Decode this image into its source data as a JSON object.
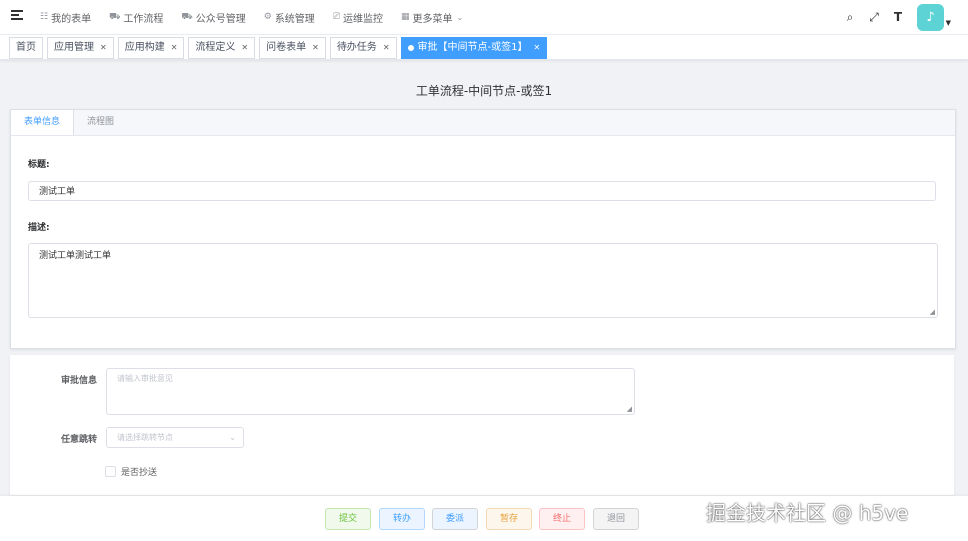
{
  "navbar": {
    "menu": [
      {
        "label": "我的表单",
        "icon": "form-icon",
        "glyph": "☷"
      },
      {
        "label": "工作流程",
        "icon": "cart-icon",
        "glyph": "⛟"
      },
      {
        "label": "公众号管理",
        "icon": "cart-icon",
        "glyph": "⛟"
      },
      {
        "label": "系统管理",
        "icon": "gear-icon",
        "glyph": "⚙"
      },
      {
        "label": "运维监控",
        "icon": "monitor-icon",
        "glyph": "⎚"
      },
      {
        "label": "更多菜单",
        "icon": "grid-icon",
        "glyph": "▦"
      }
    ],
    "tools": {
      "search": "⌕",
      "fullscreen": "⤢",
      "size": "T"
    },
    "avatar": "♪"
  },
  "tags": [
    {
      "label": "首页",
      "closable": false,
      "active": false
    },
    {
      "label": "应用管理",
      "closable": true,
      "active": false
    },
    {
      "label": "应用构建",
      "closable": true,
      "active": false
    },
    {
      "label": "流程定义",
      "closable": true,
      "active": false
    },
    {
      "label": "问卷表单",
      "closable": true,
      "active": false
    },
    {
      "label": "待办任务",
      "closable": true,
      "active": false
    },
    {
      "label": "审批【中间节点-或签1】",
      "closable": true,
      "active": true
    }
  ],
  "page": {
    "title": "工单流程-中间节点-或签1",
    "tabs": [
      "表单信息",
      "流程图"
    ],
    "form": {
      "title_label": "标题:",
      "title_value": "测试工单",
      "desc_label": "描述:",
      "desc_value": "测试工单测试工单"
    }
  },
  "approval": {
    "info_label": "审批信息",
    "info_placeholder": "请输入审批意见",
    "jump_label": "任意跳转",
    "jump_placeholder": "请选择跳转节点",
    "cc_label": "是否抄送"
  },
  "actions": {
    "submit": "提交",
    "transfer": "转办",
    "delegate": "委派",
    "save": "暂存",
    "stop": "终止",
    "back": "退回"
  },
  "watermark": "掘金技术社区 @ h5ve",
  "colors": {
    "primary": "#409eff",
    "success": "#67c23a",
    "warning": "#e6a23c",
    "danger": "#f56c6c",
    "avatar": "#5ed3d6"
  }
}
